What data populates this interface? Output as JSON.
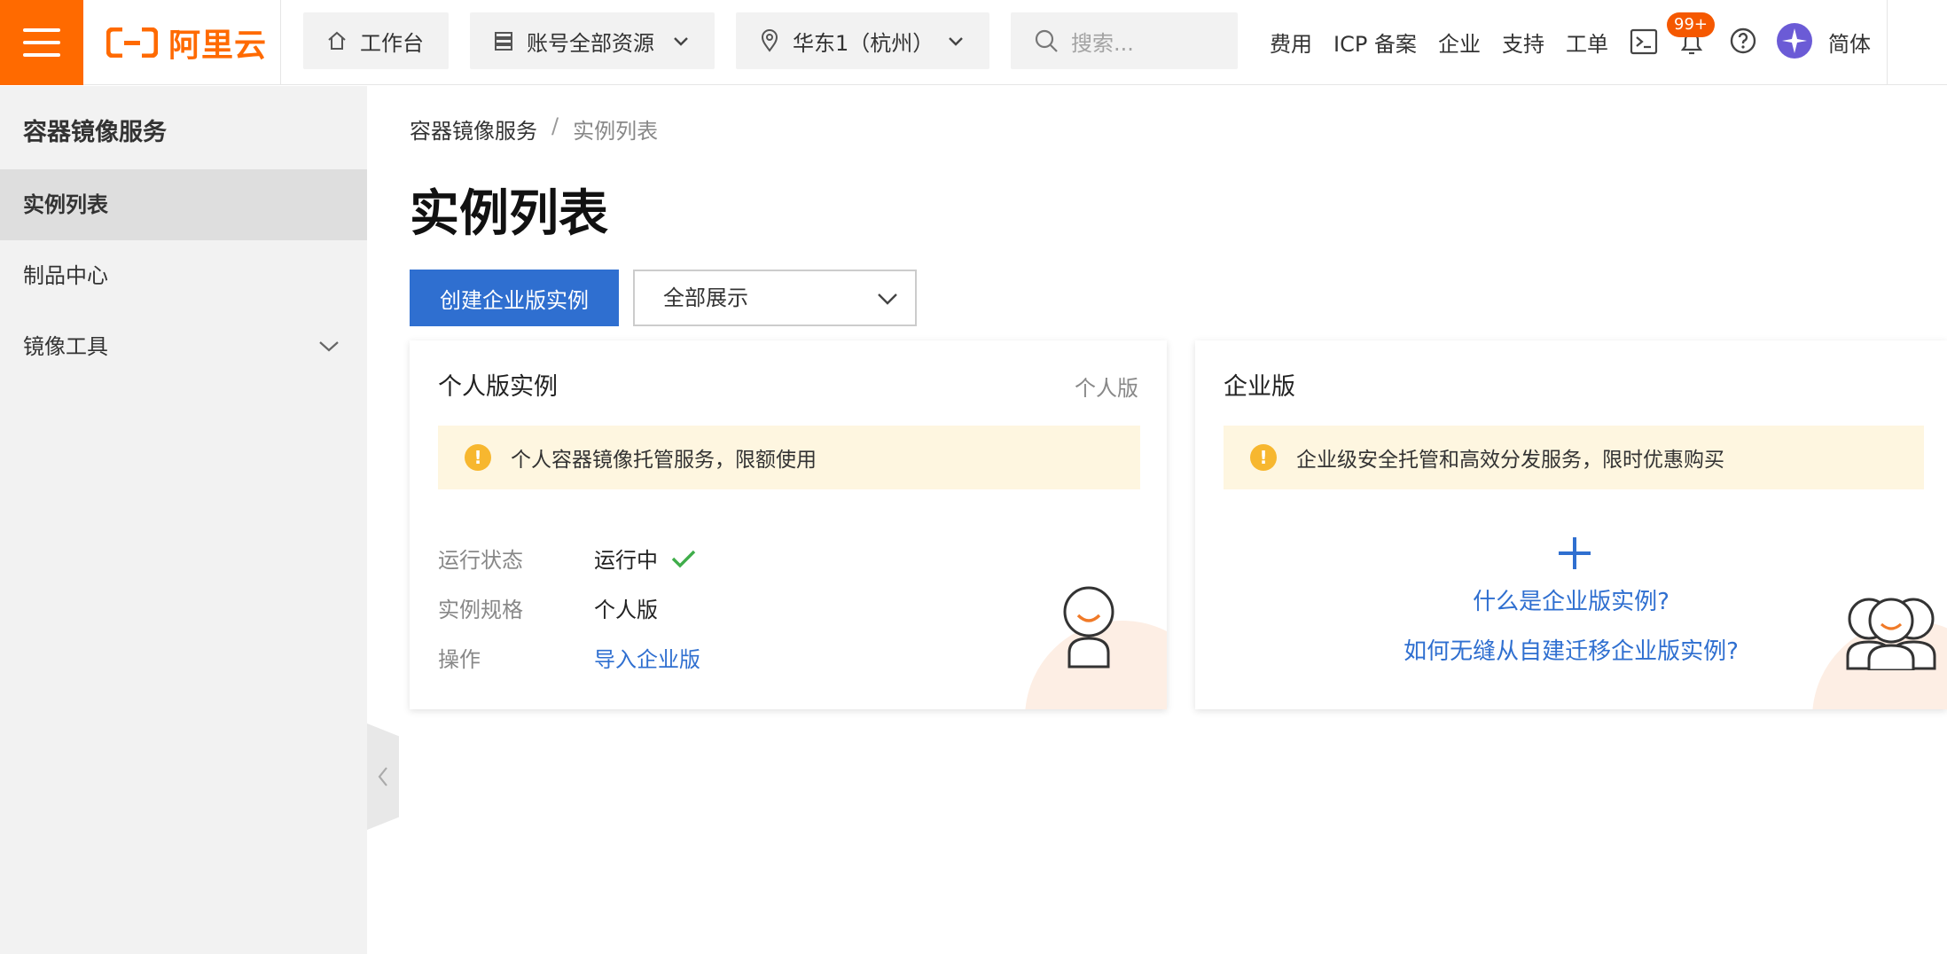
{
  "header": {
    "logo_text": "阿里云",
    "workbench": "工作台",
    "resources": "账号全部资源",
    "region": "华东1（杭州）",
    "search_placeholder": "搜索...",
    "links": [
      "费用",
      "ICP 备案",
      "企业",
      "支持",
      "工单"
    ],
    "notification_badge": "99+",
    "language": "简体",
    "brand_color": "#ff6a00"
  },
  "sidebar": {
    "title": "容器镜像服务",
    "items": [
      {
        "label": "实例列表",
        "active": true
      },
      {
        "label": "制品中心",
        "active": false
      },
      {
        "label": "镜像工具",
        "active": false,
        "expandable": true
      }
    ]
  },
  "main": {
    "breadcrumb": [
      "容器镜像服务",
      "实例列表"
    ],
    "breadcrumb_separator": "/",
    "title": "实例列表",
    "create_button": "创建企业版实例",
    "filter_select": "全部展示",
    "personal_card": {
      "title": "个人版实例",
      "tag": "个人版",
      "notice": "个人容器镜像托管服务，限额使用",
      "rows": [
        {
          "label": "运行状态",
          "value": "运行中"
        },
        {
          "label": "实例规格",
          "value": "个人版"
        },
        {
          "label": "操作",
          "value": "导入企业版"
        }
      ]
    },
    "enterprise_card": {
      "title": "企业版",
      "notice": "企业级安全托管和高效分发服务，限时优惠购买",
      "link1": "什么是企业版实例?",
      "link2": "如何无缝从自建迁移企业版实例?"
    }
  }
}
